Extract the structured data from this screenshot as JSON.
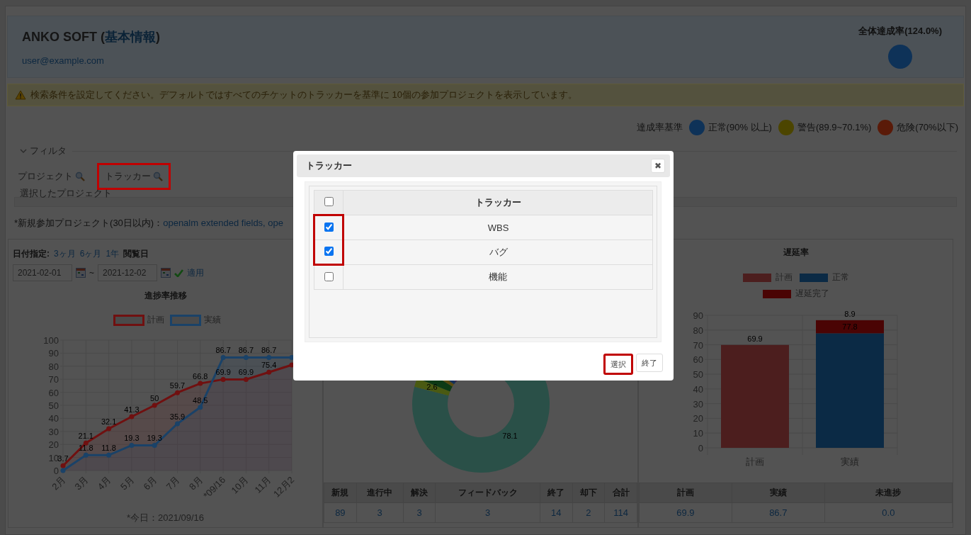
{
  "header": {
    "title_start": "ANKO SOFT (",
    "title_link": "基本情報",
    "title_end": ")",
    "email": "user@example.com",
    "rate_label": "全体達成率(124.0%)",
    "rate_ball": {
      "color": "#0e3258"
    }
  },
  "warning": {
    "text": "検索条件を設定してください。デフォルトではすべてのチケットのトラッカーを基準に 10個の参加プロジェクトを表示しています。"
  },
  "legend": {
    "label": "達成率基準",
    "items": [
      {
        "color": "#0e3258",
        "text": "正常(90% 以上)"
      },
      {
        "color": "#4c4500",
        "text": "警告(89.9~70.1%)"
      },
      {
        "color": "#5a1a08",
        "text": "危険(70%以下)"
      }
    ]
  },
  "filter": {
    "title": "フィルタ",
    "expanded": true,
    "links": [
      {
        "label": "プロジェクト",
        "highlighted": false
      },
      {
        "label": "トラッカー",
        "highlighted": true
      }
    ],
    "selected_projects_title": "選択したプロジェクト",
    "new_projects_label": "*新規参加プロジェクト(30日以内)：",
    "new_projects_link": "openalm extended fields, ope"
  },
  "progress_panel": {
    "date_label": "日付指定:",
    "ranges": [
      "3ヶ月",
      "6ヶ月",
      "1年"
    ],
    "view_date": "閲覧日",
    "from": "2021-02-01",
    "separator": "~",
    "to": "2021-12-02",
    "apply": "適用",
    "chart_data": {
      "type": "line",
      "title": "進捗率推移",
      "grid": true,
      "categories": [
        "2月",
        "3月",
        "4月",
        "5月",
        "6月",
        "7月",
        "8月",
        "*09/16",
        "10月",
        "11月",
        "12月2"
      ],
      "ylim": [
        0,
        100
      ],
      "yticks": [
        0,
        10,
        20,
        30,
        40,
        50,
        60,
        70,
        80,
        90,
        100
      ],
      "series": [
        {
          "name": "計画",
          "color": "#701010",
          "marker": "circle",
          "values": [
            3.7,
            21.1,
            32.1,
            41.3,
            50,
            59.7,
            66.8,
            69.9,
            69.9,
            75.4,
            81
          ]
        },
        {
          "name": "実績",
          "color": "#1a4268",
          "marker": "circle",
          "values": [
            0,
            11.8,
            11.8,
            19.3,
            19.3,
            35.9,
            48.5,
            86.7,
            86.7,
            86.7,
            86.7
          ]
        }
      ],
      "value_labels": [
        [
          "3.7",
          "21.1",
          "32.1",
          "41.3",
          "50",
          "59.7",
          "66.8",
          "69.9",
          "69.9",
          "75.4",
          null
        ],
        [
          null,
          "11.8",
          "11.8",
          "19.3",
          "19.3",
          "35.9",
          "48.5",
          "86.7",
          "86.7",
          "86.7",
          null
        ]
      ]
    },
    "footnote": "*今日：2021/09/16"
  },
  "status_panel": {
    "value_labels": [
      "2.6",
      "78.1"
    ],
    "table": {
      "columns": [
        "新規",
        "進行中",
        "解決",
        "フィードバック",
        "終了",
        "却下",
        "合計"
      ],
      "values": [
        "89",
        "3",
        "3",
        "3",
        "14",
        "2",
        "114"
      ]
    }
  },
  "delay_panel": {
    "chart_data": {
      "type": "bar",
      "title": "遅延率",
      "grid": true,
      "categories": [
        "計画",
        "実績"
      ],
      "stacked": true,
      "data_labels": true,
      "ylim": [
        0,
        90
      ],
      "yticks": [
        0,
        10,
        20,
        30,
        40,
        50,
        60,
        70,
        80,
        90
      ],
      "series": [
        {
          "name": "計画",
          "color": "#4c1e1e",
          "values": [
            69.9,
            null
          ]
        },
        {
          "name": "正常",
          "color": "#0b2a45",
          "values": [
            null,
            77.8
          ]
        },
        {
          "name": "遅延完了",
          "color": "#4a0404",
          "values": [
            null,
            8.9
          ]
        }
      ]
    },
    "table": {
      "columns": [
        "計画",
        "実績",
        "未進捗"
      ],
      "values": [
        "69.9",
        "86.7",
        "0.0"
      ]
    }
  },
  "dialog": {
    "title": "トラッカー",
    "close": "✖",
    "column": "トラッカー",
    "all_checked": false,
    "rows": [
      {
        "label": "WBS",
        "checked": true,
        "highlighted": true
      },
      {
        "label": "バグ",
        "checked": true,
        "highlighted": true
      },
      {
        "label": "機能",
        "checked": false,
        "highlighted": false
      }
    ],
    "buttons": [
      {
        "label": "選択",
        "highlighted": true
      },
      {
        "label": "終了",
        "highlighted": false
      }
    ]
  }
}
